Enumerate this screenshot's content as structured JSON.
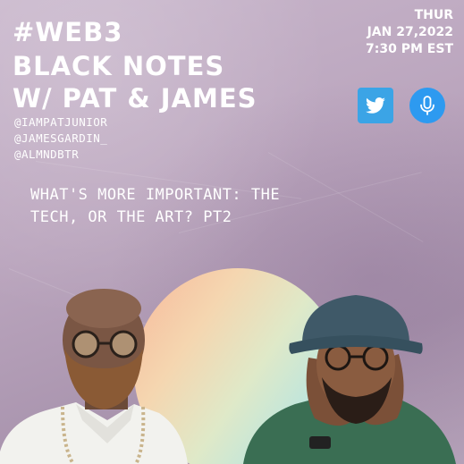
{
  "poster": {
    "title_lines": [
      "#WEB3",
      "BLACK NOTES",
      "W/ PAT & JAMES"
    ],
    "date": {
      "day": "THUR",
      "date": "JAN 27,2022",
      "time": "7:30 PM EST"
    },
    "handles": [
      "@IAMPATJUNIOR",
      "@JAMESGARDIN_",
      "@ALMNDBTR"
    ],
    "topic_lines": [
      "WHAT'S MORE IMPORTANT: THE",
      "TECH, OR THE ART? PT2"
    ],
    "icons": [
      "twitter-icon",
      "microphone-icon"
    ],
    "colors": {
      "background": "#bba6be",
      "text": "#ffffff",
      "twitter": "#3ba4e6",
      "mic": "#2d9af0"
    }
  }
}
